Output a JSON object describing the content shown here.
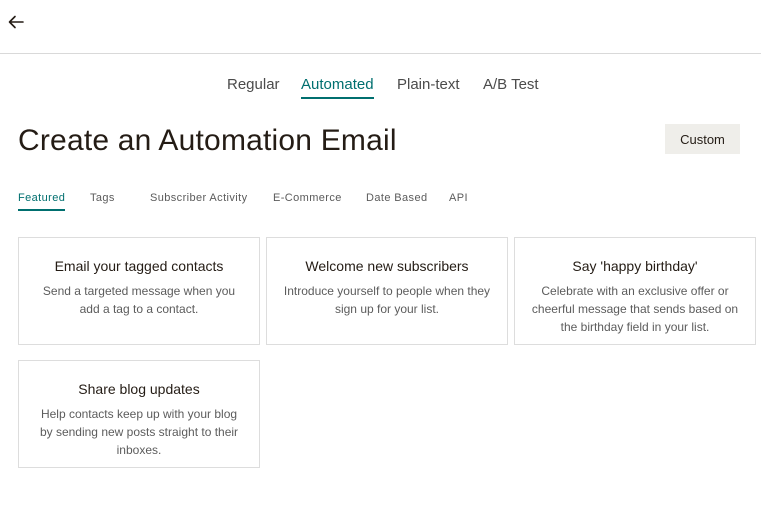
{
  "nav": {
    "back_icon": "arrow-left-icon"
  },
  "type_tabs": [
    {
      "label": "Regular",
      "active": false
    },
    {
      "label": "Automated",
      "active": true
    },
    {
      "label": "Plain-text",
      "active": false
    },
    {
      "label": "A/B Test",
      "active": false
    }
  ],
  "page": {
    "title": "Create an Automation Email",
    "custom_button": "Custom"
  },
  "category_tabs": [
    {
      "label": "Featured",
      "active": true
    },
    {
      "label": "Tags",
      "active": false
    },
    {
      "label": "Subscriber Activity",
      "active": false
    },
    {
      "label": "E-Commerce",
      "active": false
    },
    {
      "label": "Date Based",
      "active": false
    },
    {
      "label": "API",
      "active": false
    }
  ],
  "cards": [
    {
      "title": "Email your tagged contacts",
      "description": "Send a targeted message when you add a tag to a contact."
    },
    {
      "title": "Welcome new subscribers",
      "description": "Introduce yourself to people when they sign up for your list."
    },
    {
      "title": "Say 'happy birthday'",
      "description": "Celebrate with an exclusive offer or cheerful message that sends based on the birthday field in your list."
    },
    {
      "title": "Share blog updates",
      "description": "Help contacts keep up with your blog by sending new posts straight to their inboxes."
    }
  ],
  "colors": {
    "accent": "#006f6f",
    "text": "#241c15",
    "button_bg": "#efeeea",
    "border": "#dddddd"
  }
}
